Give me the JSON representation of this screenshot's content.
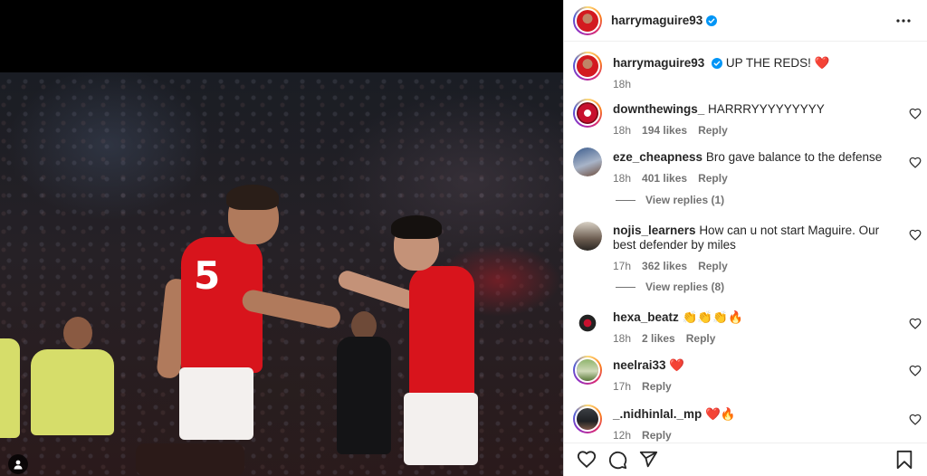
{
  "post": {
    "author": "harrymaguire93",
    "caption": "UP THE REDS! ❤️",
    "caption_time": "18h"
  },
  "comments": [
    {
      "user": "downthewings_",
      "text": "HARRRYYYYYYYYY",
      "time": "18h",
      "likes": "194 likes",
      "reply": "Reply"
    },
    {
      "user": "eze_cheapness",
      "text": "Bro gave balance to the defense",
      "time": "18h",
      "likes": "401 likes",
      "reply": "Reply",
      "view_replies": "View replies (1)"
    },
    {
      "user": "nojis_learners",
      "text": "How can u not start Maguire. Our best defender by miles",
      "time": "17h",
      "likes": "362 likes",
      "reply": "Reply",
      "view_replies": "View replies (8)"
    },
    {
      "user": "hexa_beatz",
      "text": "👏👏👏🔥",
      "time": "18h",
      "likes": "2 likes",
      "reply": "Reply"
    },
    {
      "user": "neelrai33",
      "text": "❤️",
      "time": "17h",
      "reply": "Reply"
    },
    {
      "user": "_.nidhinlal._mp",
      "text": "❤️🔥",
      "time": "12h",
      "reply": "Reply"
    }
  ],
  "icons": {
    "verified": "verified-badge-icon",
    "more": "more-options-icon",
    "like": "heart-icon",
    "comment": "comment-icon",
    "share": "share-icon",
    "save": "bookmark-icon",
    "tagged": "user-tag-icon"
  },
  "colors": {
    "verified": "#0095f6",
    "text": "#262626",
    "muted": "#737373"
  }
}
